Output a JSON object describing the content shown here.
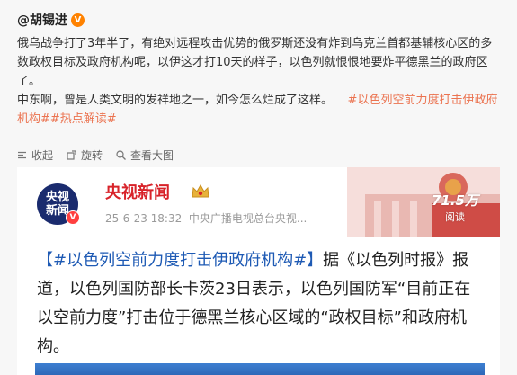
{
  "author": {
    "name": "@胡锡进",
    "badge": "V"
  },
  "post": {
    "paragraph1": "俄乌战争打了3年半了，有绝对远程攻击优势的俄罗斯还没有炸到乌克兰首都基辅核心区的多数政权目标及政府机构呢，以伊这才打10天的样子，以色列就恨恨地要炸平德黑兰的政府区了。",
    "paragraph2_text": "中东啊，曾是人类文明的发祥地之一，如今怎么烂成了这样。",
    "hashtag1": "#以色列空前力度打击伊政府机构#",
    "hashtag2": "#热点解读#"
  },
  "actions": {
    "collect": "收起",
    "rotate": "旋转",
    "view_large": "查看大图"
  },
  "embed": {
    "logo_line1": "央视",
    "logo_line2": "新闻",
    "logo_badge": "V",
    "source_name": "央视新闻",
    "date": "25-6-23 18:32",
    "source_desc": "中央广播电视总台央视...",
    "reads_count": "71.5万",
    "reads_label": "阅读",
    "tag_prefix": "【",
    "tag": "#以色列空前力度打击伊政府机构#",
    "tag_suffix": "】",
    "body": "据《以色列时报》报道，以色列国防部长卡茨23日表示，以色列国防军“目前正在以空前力度”打击位于德黑兰核心区域的“政权目标”和政府机构。"
  },
  "colors": {
    "link": "#eb7350",
    "cctv_red": "#d8232a",
    "logo_blue": "#1a2b6e",
    "tag_blue": "#1e5ab4"
  }
}
